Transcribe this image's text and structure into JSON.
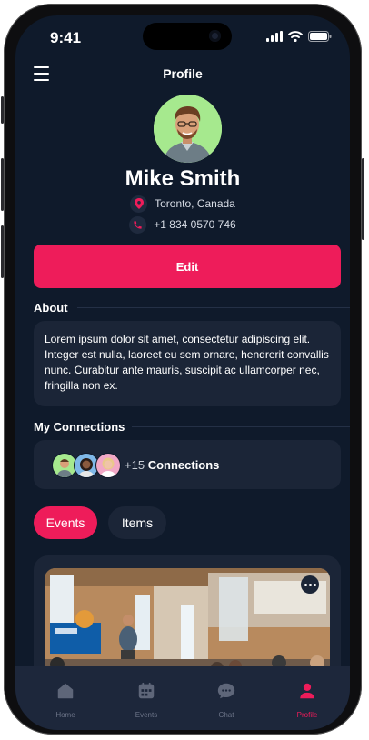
{
  "status_bar": {
    "time": "9:41"
  },
  "header": {
    "title": "Profile"
  },
  "profile": {
    "name": "Mike Smith",
    "location": "Toronto, Canada",
    "phone": "+1 834 0570 746",
    "edit_label": "Edit"
  },
  "about": {
    "title": "About",
    "text": "Lorem ipsum dolor sit amet, consectetur adipiscing elit. Integer est nulla, laoreet eu sem ornare, hendrerit convallis nunc. Curabitur ante mauris, suscipit ac ullamcorper nec, fringilla non ex."
  },
  "connections": {
    "title": "My Connections",
    "count": "+15",
    "label": "Connections"
  },
  "tabs": [
    {
      "label": "Events",
      "active": true
    },
    {
      "label": "Items",
      "active": false
    }
  ],
  "bottom_nav": [
    {
      "label": "Home",
      "icon": "home-icon"
    },
    {
      "label": "Events",
      "icon": "calendar-icon"
    },
    {
      "label": "Chat",
      "icon": "chat-icon"
    },
    {
      "label": "Profile",
      "icon": "user-icon",
      "active": true
    }
  ],
  "colors": {
    "accent": "#ee1c5a",
    "background": "#0f1a2b",
    "card": "#1b2537",
    "avatar_bg": "#a6e98e"
  }
}
